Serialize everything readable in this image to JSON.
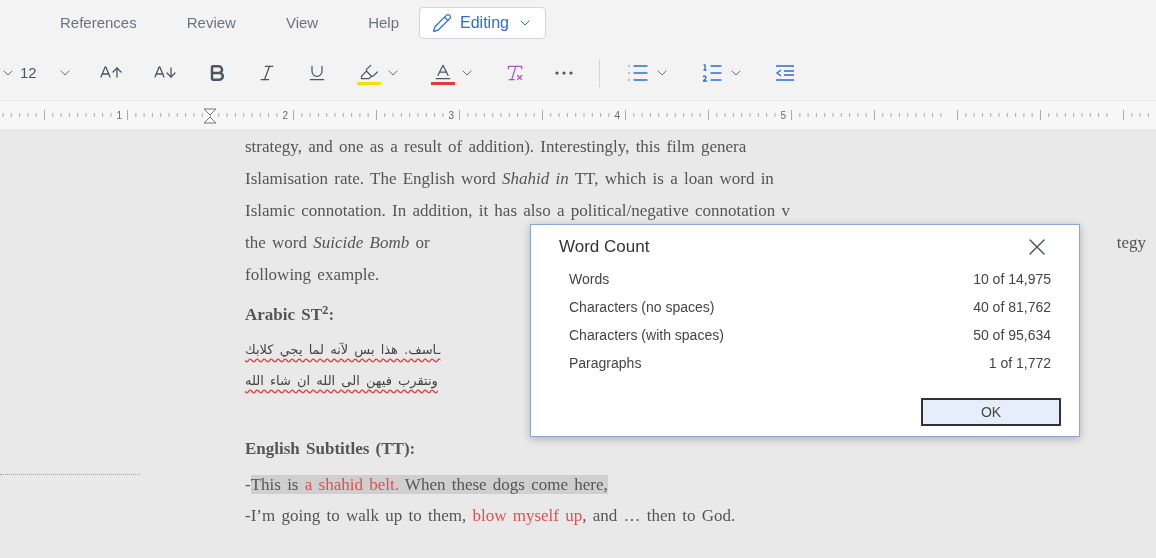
{
  "menu_tabs": [
    {
      "label": "References",
      "selected": false
    },
    {
      "label": "Review",
      "selected": false
    },
    {
      "label": "View",
      "selected": false
    },
    {
      "label": "Help",
      "selected": false
    }
  ],
  "mode_button": {
    "label": "Editing"
  },
  "toolbar": {
    "font_size": "12"
  },
  "ruler": {
    "numbers": [
      "1",
      "2",
      "3",
      "4",
      "5"
    ]
  },
  "document": {
    "paragraph": [
      "strategy, and one as a result of addition). Interestingly, this film genera",
      "Islamisation rate. The English word *Shahid in* TT, which is a loan word in",
      "Islamic connotation. In addition, it has also a political/negative connotation v"
    ],
    "paragraph_line_4": {
      "left": "the word *Suicide Bomb* or",
      "right": "tegy"
    },
    "paragraph_end": "following example.",
    "arabic_heading": "Arabic ST$^{2}$:",
    "arabic_lines": [
      {
        "text": "ـاسف. هذا بس لآنه لما يجي كلابك",
        "spell_error": true
      },
      {
        "text": "ونتقرب فيهن الى الله ان شاء الله",
        "spell_error": true
      }
    ],
    "english_heading": "English Subtitles (TT):",
    "english_lines": [
      [
        {
          "text": "-",
          "red": false,
          "highlighted": false
        },
        {
          "text": "This is ",
          "red": false,
          "highlighted": true
        },
        {
          "text": "a shahid belt.",
          "red": true,
          "highlighted": true
        },
        {
          "text": " When these dogs come here,",
          "red": false,
          "highlighted": true
        }
      ],
      [
        {
          "text": "-I’m going to walk up to them, ",
          "red": false,
          "highlighted": false
        },
        {
          "text": "blow myself up",
          "red": true,
          "highlighted": false
        },
        {
          "text": ", and … then to God.",
          "red": false,
          "highlighted": false
        }
      ]
    ]
  },
  "dialog": {
    "title": "Word Count",
    "rows": [
      {
        "label": "Words",
        "value": "10 of 14,975"
      },
      {
        "label": "Characters (no spaces)",
        "value": "40 of 81,762"
      },
      {
        "label": "Characters (with spaces)",
        "value": "50 of 95,634"
      },
      {
        "label": "Paragraphs",
        "value": "1 of 1,772"
      }
    ],
    "ok_button": "OK"
  }
}
